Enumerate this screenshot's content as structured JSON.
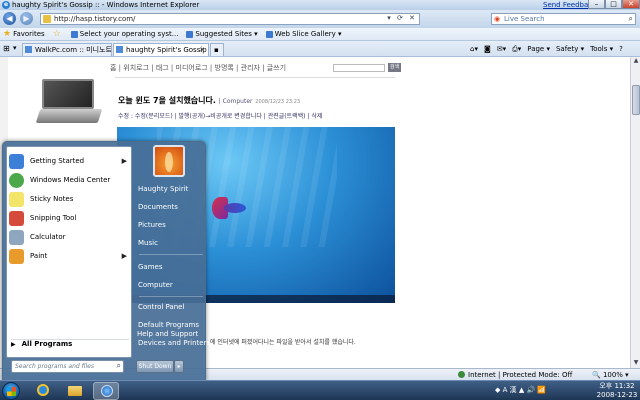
{
  "window": {
    "title": "haughty Spirit's Gossip :: - Windows Internet Explorer",
    "feedback": "Send Feedback",
    "min": "–",
    "max": "□",
    "close": "✕"
  },
  "address": {
    "url": "http://hasp.tistory.com/",
    "search_placeholder": "Live Search"
  },
  "favorites": {
    "label": "Favorites",
    "items": [
      "Select your operating syst...",
      "Suggested Sites ▾",
      "Web Slice Gallery ▾"
    ]
  },
  "tabs": [
    {
      "label": "WalkPc.com :: 미니노트북,..."
    },
    {
      "label": "haughty Spirit's Gossip ::"
    }
  ],
  "commandbar": {
    "page": "Page ▾",
    "safety": "Safety ▾",
    "tools": "Tools ▾",
    "help": "?"
  },
  "blog": {
    "nav": "홈 | 위치로그 | 태그 | 미디어로그 | 방명록 | 관리자 | 글쓰기",
    "search_btn": "검색",
    "post_title": "오늘 윈도 7을 설치했습니다.",
    "post_category": "| Computer",
    "post_date": "2008/12/23 23:23",
    "post_meta": "수정 : 수정(분리모드) | 발행(공개)→비공개로 변경합니다 | 관련글(트랙백) | 삭제",
    "post_body": "에 인터넷에 퍼졌어다니는 파일을 받아서 설치를 했습니다."
  },
  "status": {
    "zone": "Internet | Protected Mode: Off",
    "zoom": "🔍 100% ▾"
  },
  "startmenu": {
    "left_items": [
      {
        "label": "Getting Started",
        "icon": "getting-started-icon",
        "color": "#3b7fd6",
        "submenu": true
      },
      {
        "label": "Windows Media Center",
        "icon": "media-center-icon",
        "color": "#4aa84a",
        "submenu": false
      },
      {
        "label": "Sticky Notes",
        "icon": "sticky-notes-icon",
        "color": "#f3e46a",
        "submenu": false
      },
      {
        "label": "Snipping Tool",
        "icon": "snipping-tool-icon",
        "color": "#d64a3b",
        "submenu": false
      },
      {
        "label": "Calculator",
        "icon": "calculator-icon",
        "color": "#8fa6bf",
        "submenu": false
      },
      {
        "label": "Paint",
        "icon": "paint-icon",
        "color": "#e89a2a",
        "submenu": true
      }
    ],
    "all_programs": "All Programs",
    "search_placeholder": "Search programs and files",
    "right_items": [
      "Haughty Spirit",
      "Documents",
      "Pictures",
      "Music",
      "Games",
      "Computer",
      "Control Panel",
      "Default Programs",
      "Devices and Printers",
      "Help and Support"
    ],
    "shutdown": "Shut Down",
    "shutdown_arrow": "▸"
  },
  "taskbar": {
    "tray": "◆ A 漢 ▲ 🔊 📶",
    "time": "오후 11:32",
    "date": "2008-12-23"
  }
}
